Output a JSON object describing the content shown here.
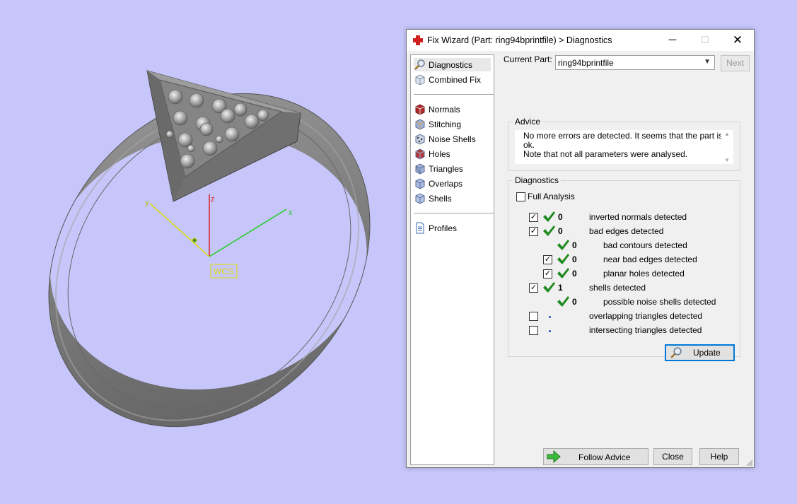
{
  "window": {
    "title": "Fix Wizard (Part: ring94bprintfile) > Diagnostics",
    "controls": {
      "minimize": "─",
      "maximize": "☐",
      "close": "✕"
    }
  },
  "viewport": {
    "axis_labels": {
      "x": "x",
      "y": "y",
      "z": "z"
    },
    "wcs_label": "WCS",
    "axis_colors": {
      "x": "#22cc22",
      "y": "#dddd00",
      "z": "#dd2222"
    }
  },
  "nav": {
    "items": [
      {
        "label": "Diagnostics",
        "icon": "magnifier-icon",
        "active": true
      },
      {
        "label": "Combined Fix",
        "icon": "cube-icon"
      },
      {
        "label": "Normals",
        "icon": "normals-cube-icon"
      },
      {
        "label": "Stitching",
        "icon": "stitching-cube-icon"
      },
      {
        "label": "Noise Shells",
        "icon": "noise-shells-icon"
      },
      {
        "label": "Holes",
        "icon": "holes-cube-icon"
      },
      {
        "label": "Triangles",
        "icon": "triangles-cube-icon"
      },
      {
        "label": "Overlaps",
        "icon": "overlaps-cube-icon"
      },
      {
        "label": "Shells",
        "icon": "shells-cube-icon"
      },
      {
        "label": "Profiles",
        "icon": "document-icon"
      }
    ]
  },
  "current_part": {
    "label": "Current Part:",
    "value": "ring94bprintfile",
    "next_label": "Next"
  },
  "advice": {
    "title": "Advice",
    "line1": "No more errors are detected. It seems that the part is ok.",
    "line2": "Note that not all parameters were analysed."
  },
  "diagnostics": {
    "title": "Diagnostics",
    "full_analysis_label": "Full Analysis",
    "full_analysis_checked": false,
    "rows": [
      {
        "checkbox": true,
        "checked": true,
        "status": "ok",
        "count": "0",
        "label": "inverted normals detected",
        "indent": 0
      },
      {
        "checkbox": true,
        "checked": true,
        "status": "ok",
        "count": "0",
        "label": "bad edges detected",
        "indent": 0
      },
      {
        "checkbox": false,
        "checked": false,
        "status": "ok",
        "count": "0",
        "label": "bad contours detected",
        "indent": 1
      },
      {
        "checkbox": true,
        "checked": true,
        "status": "ok",
        "count": "0",
        "label": "near bad edges detected",
        "indent": 1
      },
      {
        "checkbox": true,
        "checked": true,
        "status": "ok",
        "count": "0",
        "label": "planar holes detected",
        "indent": 1
      },
      {
        "checkbox": true,
        "checked": true,
        "status": "ok",
        "count": "1",
        "label": "shells detected",
        "indent": 0
      },
      {
        "checkbox": false,
        "checked": false,
        "status": "ok",
        "count": "0",
        "label": "possible noise shells detected",
        "indent": 1
      },
      {
        "checkbox": true,
        "checked": false,
        "status": "none",
        "count": "",
        "label": "overlapping triangles detected",
        "indent": 0
      },
      {
        "checkbox": true,
        "checked": false,
        "status": "none",
        "count": "",
        "label": "intersecting triangles detected",
        "indent": 0
      }
    ],
    "update_label": "Update"
  },
  "footer": {
    "follow_advice_label": "Follow Advice",
    "close_label": "Close",
    "help_label": "Help"
  },
  "colors": {
    "background": "#c6c6fb",
    "check_green": "#1e8a1e",
    "focus_blue": "#0078d7"
  }
}
